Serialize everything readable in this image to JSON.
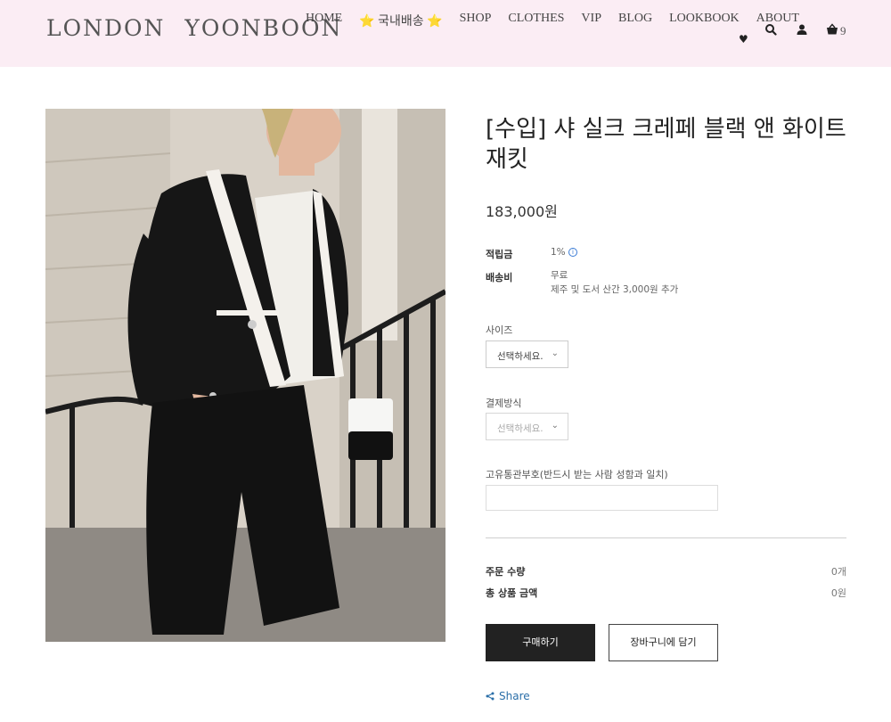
{
  "header": {
    "logo": "LONDON YOONBOON",
    "nav": [
      "HOME",
      "⭐ 국내배송 ⭐",
      "SHOP",
      "CLOTHES",
      "VIP",
      "BLOG",
      "LOOKBOOK",
      "ABOUT"
    ],
    "heart": "♥",
    "cart_count": "9",
    "icons": [
      "search-icon",
      "user-icon",
      "cart-icon"
    ]
  },
  "product": {
    "title": "[수입] 샤 실크 크레페 블랙 앤 화이트 재킷",
    "price": "183,000원",
    "points_label": "적립금",
    "points_value": "1%",
    "shipping_label": "배송비",
    "shipping_value": "무료",
    "shipping_note": "제주 및 도서 산간 3,000원 추가"
  },
  "options": {
    "size_label": "사이즈",
    "size_value": "선택하세요.",
    "payment_label": "결제방식",
    "payment_value": "선택하세요.",
    "customs_label": "고유통관부호(반드시 받는 사람 성함과 일치)",
    "customs_value": ""
  },
  "summary": {
    "qty_label": "주문 수량",
    "qty_value": "0개",
    "total_label": "총 상품 금액",
    "total_value": "0원"
  },
  "actions": {
    "buy": "구매하기",
    "add_to_cart": "장바구니에 담기",
    "share": "Share"
  },
  "colors": {
    "header_bg": "#fbedf4",
    "buy_button": "#222222",
    "link": "#2a6ea8"
  }
}
